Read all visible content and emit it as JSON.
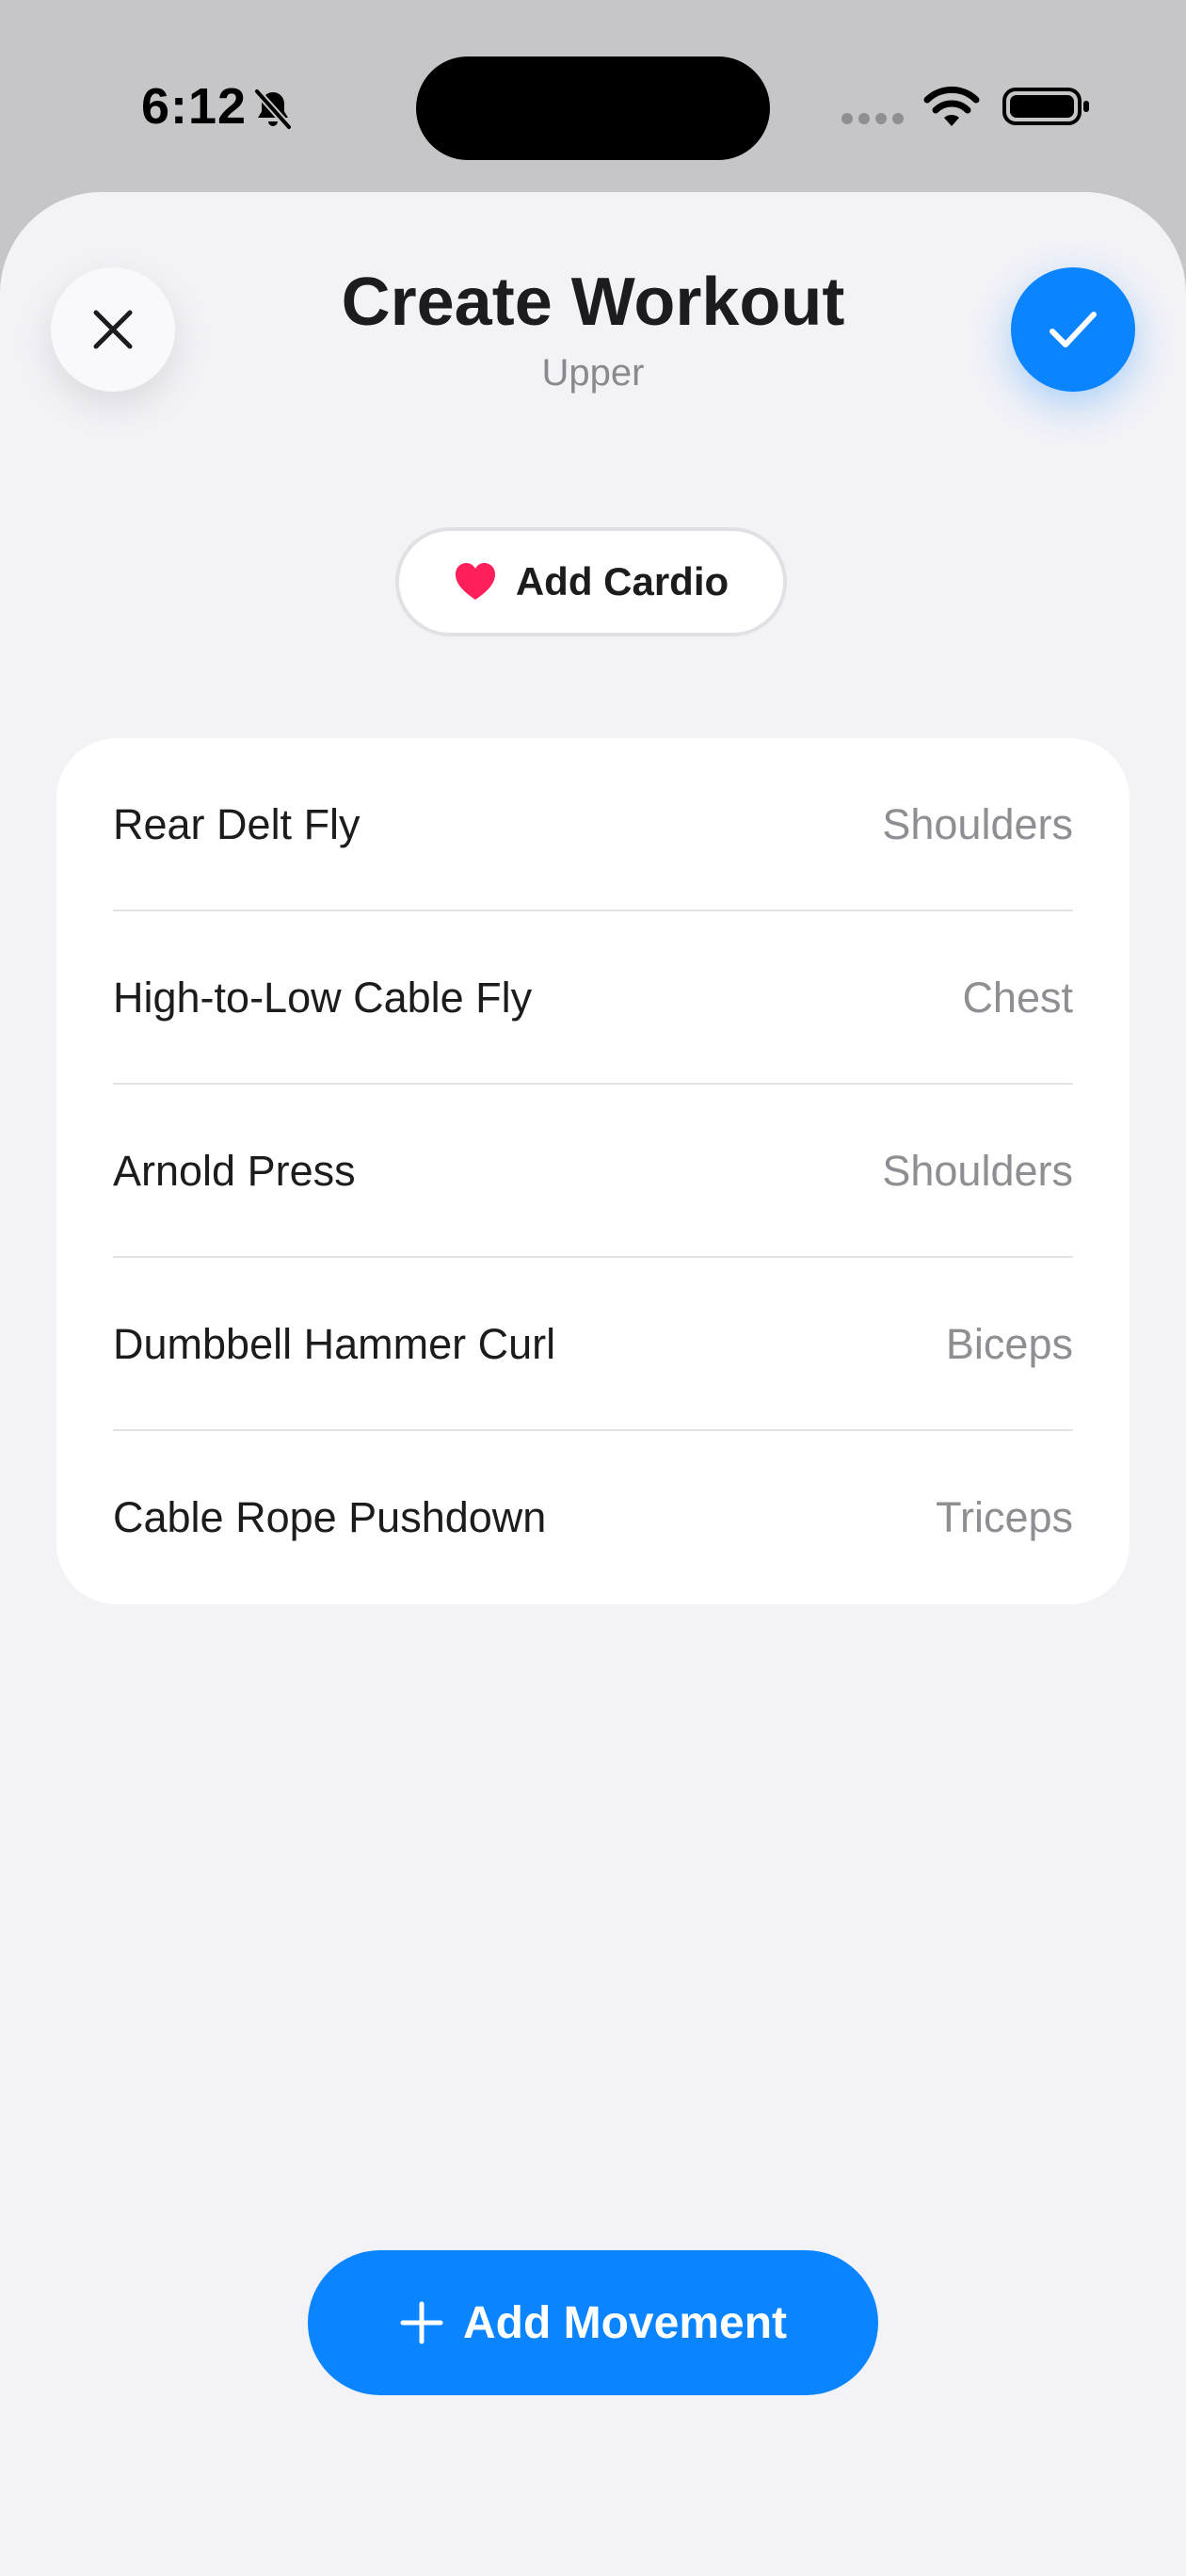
{
  "status_bar": {
    "time": "6:12",
    "icons": [
      "bell-slash-icon",
      "cellular-dots-icon",
      "wifi-icon",
      "battery-icon"
    ]
  },
  "header": {
    "title": "Create Workout",
    "subtitle": "Upper",
    "close_icon": "close-icon",
    "confirm_icon": "checkmark-icon"
  },
  "cardio": {
    "label": "Add Cardio",
    "icon": "heart-icon",
    "icon_color": "#ff1f5b"
  },
  "movements": [
    {
      "name": "Rear Delt Fly",
      "group": "Shoulders"
    },
    {
      "name": "High-to-Low Cable Fly",
      "group": "Chest"
    },
    {
      "name": "Arnold Press",
      "group": "Shoulders"
    },
    {
      "name": "Dumbbell Hammer Curl",
      "group": "Biceps"
    },
    {
      "name": "Cable Rope Pushdown",
      "group": "Triceps"
    }
  ],
  "add_movement": {
    "label": "Add Movement",
    "icon": "plus-icon"
  },
  "colors": {
    "accent": "#0a84ff",
    "background": "#f2f2f7",
    "secondary_text": "#8e8e93"
  }
}
